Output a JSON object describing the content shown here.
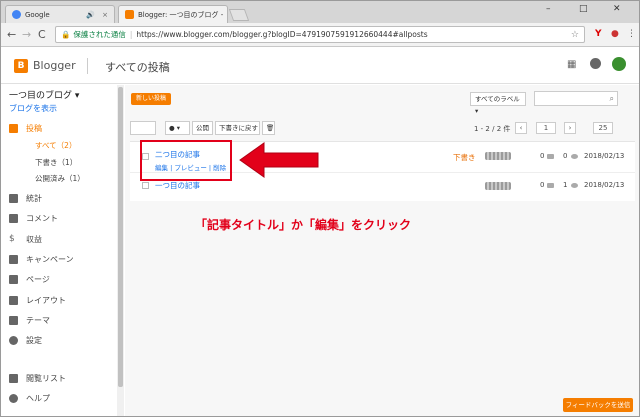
{
  "browser": {
    "tabs": [
      {
        "title": "Google",
        "active": false
      },
      {
        "title": "Blogger: 一つ目のブログ -",
        "active": true
      }
    ],
    "window_controls": [
      "–",
      "□",
      "✕"
    ],
    "security_label": "保護された通信",
    "url": "https://www.blogger.com/blogger.g?blogID=4791907591912660444#allposts",
    "nav": {
      "back": "←",
      "forward": "→",
      "reload": "C"
    }
  },
  "header": {
    "brand": "Blogger",
    "section": "すべての投稿"
  },
  "sidebar": {
    "blog_name": "一つ目のブログ ▾",
    "view_blog": "ブログを表示",
    "posts_label": "投稿",
    "sub_items": [
      {
        "label": "すべて（2）",
        "active": true
      },
      {
        "label": "下書き（1）",
        "active": false
      },
      {
        "label": "公開済み（1）",
        "active": false
      }
    ],
    "items": [
      {
        "label": "統計",
        "icon": "stats-icon"
      },
      {
        "label": "コメント",
        "icon": "comment-icon"
      },
      {
        "label": "収益",
        "icon": "earnings-icon"
      },
      {
        "label": "キャンペーン",
        "icon": "campaign-icon"
      },
      {
        "label": "ページ",
        "icon": "pages-icon"
      },
      {
        "label": "レイアウト",
        "icon": "layout-icon"
      },
      {
        "label": "テーマ",
        "icon": "theme-icon"
      },
      {
        "label": "設定",
        "icon": "settings-icon"
      },
      {
        "label": "閲覧リスト",
        "icon": "reading-list-icon"
      },
      {
        "label": "ヘルプ",
        "icon": "help-icon"
      }
    ]
  },
  "main": {
    "new_post": "新しい投稿",
    "labels_dropdown": "すべてのラベル ▾",
    "actions": {
      "label_button": "▾",
      "publish": "公開",
      "revert": "下書きに戻す"
    },
    "pager": {
      "range": "1 - 2 / 2 件",
      "page": "1",
      "per_page": "25"
    },
    "posts": [
      {
        "title": "二つ目の記事",
        "actions": "編集 | プレビュー | 削除",
        "status": "下書き",
        "comments": "0",
        "views": "0",
        "date": "2018/02/13"
      },
      {
        "title": "一つ目の記事",
        "status": "",
        "comments": "0",
        "views": "1",
        "date": "2018/02/13"
      }
    ]
  },
  "annotation": {
    "caption": "「記事タイトル」か「編集」をクリック",
    "color": "#e2001a"
  },
  "feedback_button": "フィードバックを送信"
}
